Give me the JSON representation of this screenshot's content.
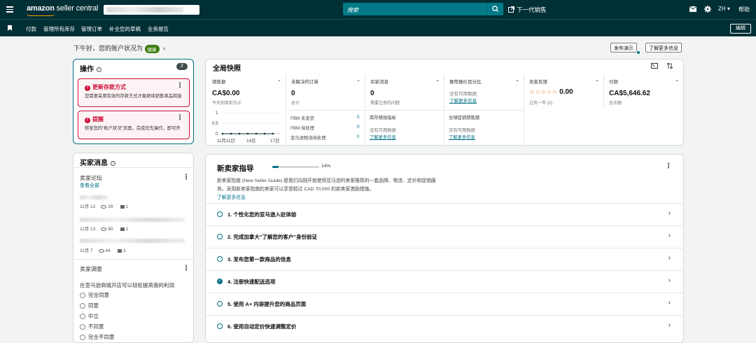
{
  "topbar": {
    "logo_main": "amazon",
    "logo_sub": " seller central",
    "search_placeholder": "搜索",
    "next_gen": "下一代销售",
    "lang": "ZH ▾",
    "help": "帮助"
  },
  "navbar": {
    "items": [
      "付款",
      "管理所有库存",
      "管理订单",
      "补全您的草稿",
      "业务报告"
    ],
    "edit": "编辑"
  },
  "greeting": {
    "text": "下午好，您的账户状况为",
    "status": "健康",
    "arrow": "›"
  },
  "top_buttons": {
    "publish_demo": "发布演示",
    "learn_more": "了解更多信息"
  },
  "operations": {
    "title": "操作",
    "count": "2",
    "alerts": [
      {
        "title": "更新存款方式",
        "desc": "您需要采用有效的存款方式才能继续销售商品和接"
      },
      {
        "title": "提醒",
        "desc": "转至您的\"账户状况\"页面，完成优先操作，即可开"
      }
    ]
  },
  "snapshot": {
    "title": "全局快照",
    "metrics": [
      {
        "label": "销售额",
        "value": "CA$0.00",
        "sub": "今天到目前为止"
      },
      {
        "label": "未解决的订单",
        "value": "0",
        "sub": "总计"
      },
      {
        "label": "买家消息",
        "value": "0",
        "sub": "需要注意的问题"
      },
      {
        "label": "推荐报价百分比",
        "note": "没有可用数据",
        "link": "了解更多信息"
      },
      {
        "label": "卖家反馈",
        "value": "0.00",
        "sub": "过去一年 (0)"
      },
      {
        "label": "付款",
        "value": "CA$5,646.62",
        "sub": "总余额"
      }
    ],
    "chart": {
      "y_ticks": [
        "1",
        "0.5",
        "0"
      ],
      "x_ticks": [
        "11月11日",
        "14日",
        "17日"
      ]
    },
    "fulfillment": [
      {
        "label": "FBM 未发货",
        "value": "0"
      },
      {
        "label": "FBM 待处理",
        "value": "0"
      },
      {
        "label": "亚马逊物流待处理",
        "value": "0"
      }
    ],
    "inventory": {
      "label": "库存绩效指标",
      "note": "没有可用数据",
      "link": "了解更多信息"
    },
    "global_promo": {
      "label": "全球促销销售额",
      "note": "没有可用数据",
      "link": "了解更多信息"
    }
  },
  "buyer_messages": {
    "title": "买家消息",
    "forum_title": "卖家论坛",
    "view_all": "查看全部",
    "posts": [
      {
        "date": "11月 13",
        "views": "39",
        "comments": "1"
      },
      {
        "date": "11月 13",
        "views": "80",
        "comments": "1"
      },
      {
        "date": "11月 7",
        "views": "44",
        "comments": "3"
      }
    ],
    "survey_title": "卖家调查",
    "survey_question": "在亚马逊商城开店可以轻松提高我的利润",
    "options": [
      "完全同意",
      "同意",
      "中立",
      "不同意",
      "完全不同意"
    ]
  },
  "guide": {
    "title": "新卖家指导",
    "progress_label": "14%",
    "progress": 0.14,
    "desc1": "新卖家指南 (New Seller Guide) 是我们向刚开始使用亚马逊的卖家推荐的一套品牌、物流、定价和促销服",
    "desc2": "务。采用新卖家指南的卖家可以享受超过 CAD 70,000 的新卖家激励措施。",
    "learn_more": "了解更多信息",
    "steps": [
      {
        "label": "1. 个性化您的亚马逊入驻体验",
        "done": false
      },
      {
        "label": "2. 完成加拿大\"了解您的客户\"身份验证",
        "done": false
      },
      {
        "label": "3. 发布您第一款商品的信息",
        "done": false
      },
      {
        "label": "4. 注册快速配送选项",
        "done": true
      },
      {
        "label": "5. 使用 A+ 内容提升您的商品页面",
        "done": false
      },
      {
        "label": "6. 使用自动定价快速调整定价",
        "done": false
      }
    ]
  }
}
